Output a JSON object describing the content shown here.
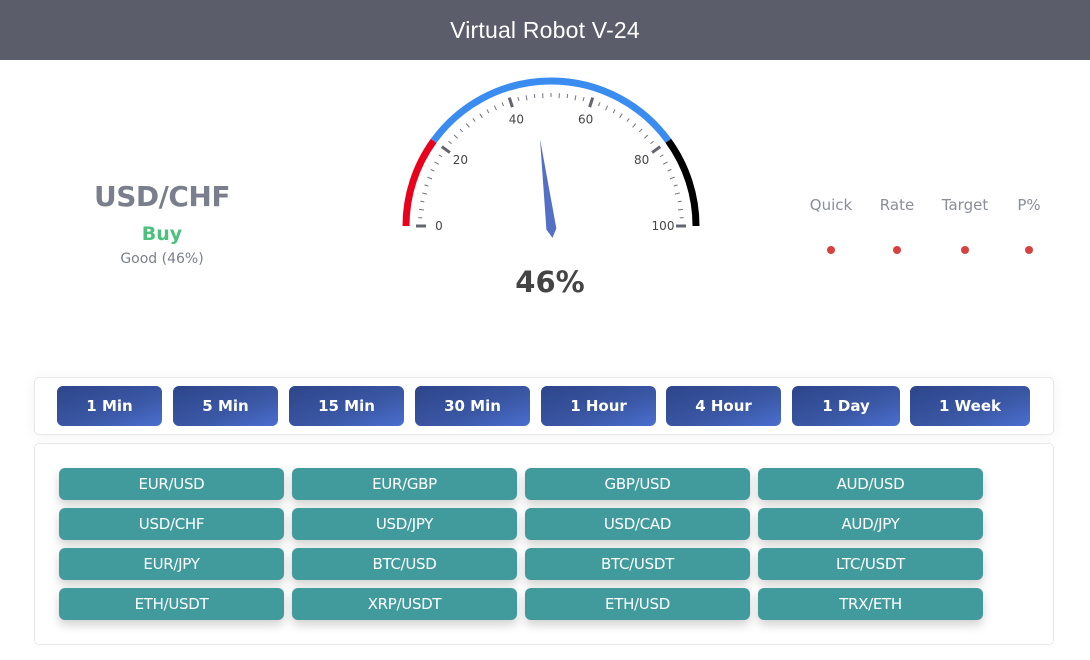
{
  "header": {
    "title": "Virtual Robot V-24"
  },
  "pair_panel": {
    "pair": "USD/CHF",
    "signal": "Buy",
    "signal_desc": "Good (46%)",
    "signal_color": "#4cc07d"
  },
  "gauge": {
    "value": 46,
    "value_label": "46%",
    "min": 0,
    "max": 100,
    "tick_labels": [
      "0",
      "20",
      "40",
      "60",
      "80",
      "100"
    ],
    "bands": [
      {
        "from": 0,
        "to": 20,
        "color": "#e8001c"
      },
      {
        "from": 20,
        "to": 80,
        "color": "#3b8cf0"
      },
      {
        "from": 80,
        "to": 100,
        "color": "#000000"
      }
    ],
    "needle_color": "#5470c6"
  },
  "stats": [
    {
      "label": "Quick",
      "status_color": "#d94040"
    },
    {
      "label": "Rate",
      "status_color": "#d94040"
    },
    {
      "label": "Target",
      "status_color": "#d94040"
    },
    {
      "label": "P%",
      "status_color": "#d94040"
    }
  ],
  "timeframes": [
    "1 Min",
    "5 Min",
    "15 Min",
    "30 Min",
    "1 Hour",
    "4 Hour",
    "1 Day",
    "1 Week"
  ],
  "pairs": [
    [
      "EUR/USD",
      "EUR/GBP",
      "GBP/USD",
      "AUD/USD"
    ],
    [
      "USD/CHF",
      "USD/JPY",
      "USD/CAD",
      "AUD/JPY"
    ],
    [
      "EUR/JPY",
      "BTC/USD",
      "BTC/USDT",
      "LTC/USDT"
    ],
    [
      "ETH/USDT",
      "XRP/USDT",
      "ETH/USD",
      "TRX/ETH"
    ]
  ]
}
